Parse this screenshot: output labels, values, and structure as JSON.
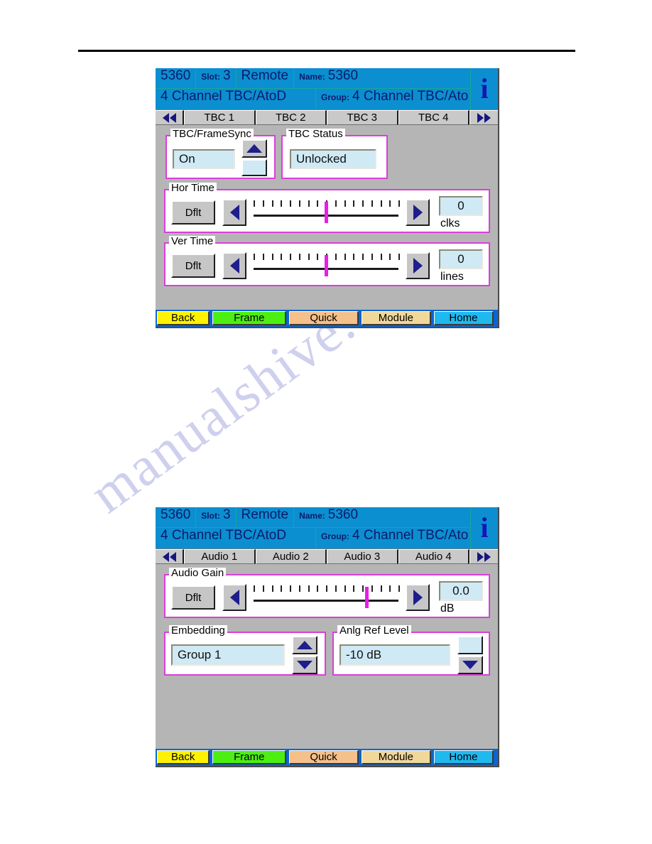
{
  "page": {
    "watermark": "manualshive.com"
  },
  "panels": [
    {
      "id": "tbc",
      "header": {
        "device_id": "5360",
        "slot_label": "Slot:",
        "slot_value": "3",
        "mode": "Remote",
        "name_label": "Name:",
        "name_value": "5360",
        "product": "4 Channel TBC/AtoD",
        "group_label": "Group:",
        "group_value": "4 Channel TBC/Ato",
        "info_icon": "info-icon"
      },
      "tabs": {
        "prev_icon": "double-arrow-left-icon",
        "next_icon": "double-arrow-right-icon",
        "items": [
          "TBC 1",
          "TBC 2",
          "TBC 3",
          "TBC 4"
        ],
        "selected": "TBC 1"
      },
      "groups": {
        "framesync": {
          "legend": "TBC/FrameSync",
          "value": "On",
          "up_icon": "triangle-up-icon",
          "down_blank": ""
        },
        "status": {
          "legend": "TBC Status",
          "value": "Unlocked"
        },
        "hor_time": {
          "legend": "Hor Time",
          "default_label": "Dflt",
          "dec_icon": "triangle-left-icon",
          "inc_icon": "triangle-right-icon",
          "value": "0",
          "unit": "clks",
          "thumb_percent": 50,
          "tick_count": 17
        },
        "ver_time": {
          "legend": "Ver Time",
          "default_label": "Dflt",
          "dec_icon": "triangle-left-icon",
          "inc_icon": "triangle-right-icon",
          "value": "0",
          "unit": "lines",
          "thumb_percent": 50,
          "tick_count": 17
        }
      },
      "commands": [
        {
          "label": "Back",
          "color": "#fff200",
          "width": 76
        },
        {
          "label": "Frame",
          "color": "#4dee12",
          "width": 106
        },
        {
          "label": "Quick",
          "color": "#f6c08a",
          "width": 100
        },
        {
          "label": "Module",
          "color": "#f0d79a",
          "width": 100
        },
        {
          "label": "Home",
          "color": "#1fb8ef",
          "width": 86
        }
      ]
    },
    {
      "id": "audio",
      "header": {
        "device_id": "5360",
        "slot_label": "Slot:",
        "slot_value": "3",
        "mode": "Remote",
        "name_label": "Name:",
        "name_value": "5360",
        "product": "4 Channel TBC/AtoD",
        "group_label": "Group:",
        "group_value": "4 Channel TBC/Ato",
        "info_icon": "info-icon"
      },
      "tabs": {
        "prev_icon": "double-arrow-left-icon",
        "next_icon": "double-arrow-right-icon",
        "items": [
          "Audio 1",
          "Audio 2",
          "Audio 3",
          "Audio 4"
        ],
        "selected": "Audio 1"
      },
      "groups": {
        "audio_gain": {
          "legend": "Audio Gain",
          "default_label": "Dflt",
          "dec_icon": "triangle-left-icon",
          "inc_icon": "triangle-right-icon",
          "value": "0.0",
          "unit": "dB",
          "thumb_percent": 78,
          "tick_count": 17
        },
        "embedding": {
          "legend": "Embedding",
          "value": "Group 1",
          "up_icon": "triangle-up-icon",
          "down_icon": "triangle-down-icon"
        },
        "anlg_ref": {
          "legend": "Anlg Ref Level",
          "value": "-10 dB",
          "up_blank": "",
          "down_icon": "triangle-down-icon"
        }
      },
      "commands": [
        {
          "label": "Back",
          "color": "#fff200",
          "width": 76
        },
        {
          "label": "Frame",
          "color": "#4dee12",
          "width": 106
        },
        {
          "label": "Quick",
          "color": "#f6c08a",
          "width": 100
        },
        {
          "label": "Module",
          "color": "#f0d79a",
          "width": 100
        },
        {
          "label": "Home",
          "color": "#1fb8ef",
          "width": 86
        }
      ]
    }
  ]
}
